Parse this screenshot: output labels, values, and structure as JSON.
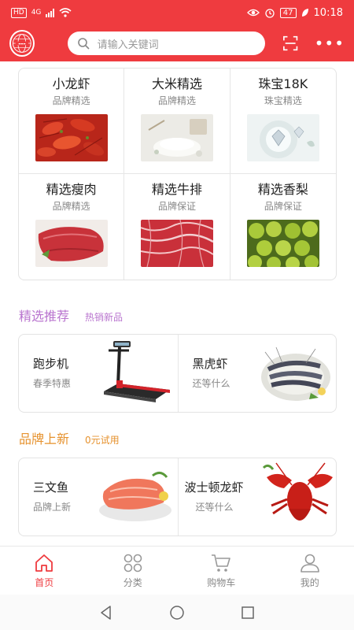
{
  "status": {
    "left_icon": "HD",
    "network": "4G",
    "battery": "47",
    "time": "10:18"
  },
  "search": {
    "placeholder": "请输入关键词"
  },
  "grid": [
    {
      "title": "小龙虾",
      "subtitle": "品牌精选",
      "image": "crayfish"
    },
    {
      "title": "大米精选",
      "subtitle": "品牌精选",
      "image": "rice"
    },
    {
      "title": "珠宝18K",
      "subtitle": "珠宝精选",
      "image": "jewelry"
    },
    {
      "title": "精选瘦肉",
      "subtitle": "品牌精选",
      "image": "lean-meat"
    },
    {
      "title": "精选牛排",
      "subtitle": "品牌保证",
      "image": "steak"
    },
    {
      "title": "精选香梨",
      "subtitle": "品牌保证",
      "image": "pears"
    }
  ],
  "section1": {
    "title": "精选推荐",
    "subtitle": "热销新品",
    "color": "#b975cf",
    "cards": [
      {
        "title": "跑步机",
        "subtitle": "春季特惠",
        "image": "treadmill"
      },
      {
        "title": "黑虎虾",
        "subtitle": "还等什么",
        "image": "tiger-shrimp"
      }
    ]
  },
  "section2": {
    "title": "品牌上新",
    "subtitle": "0元试用",
    "color": "#e6922e",
    "cards": [
      {
        "title": "三文鱼",
        "subtitle": "品牌上新",
        "image": "salmon"
      },
      {
        "title": "波士顿龙虾",
        "subtitle": "还等什么",
        "image": "lobster"
      }
    ]
  },
  "tabs": [
    {
      "label": "首页",
      "icon": "home-icon",
      "active": true
    },
    {
      "label": "分类",
      "icon": "category-icon",
      "active": false
    },
    {
      "label": "购物车",
      "icon": "cart-icon",
      "active": false
    },
    {
      "label": "我的",
      "icon": "user-icon",
      "active": false
    }
  ],
  "colors": {
    "brand": "#ef3b3f",
    "active_tab": "#ef3b3f"
  }
}
